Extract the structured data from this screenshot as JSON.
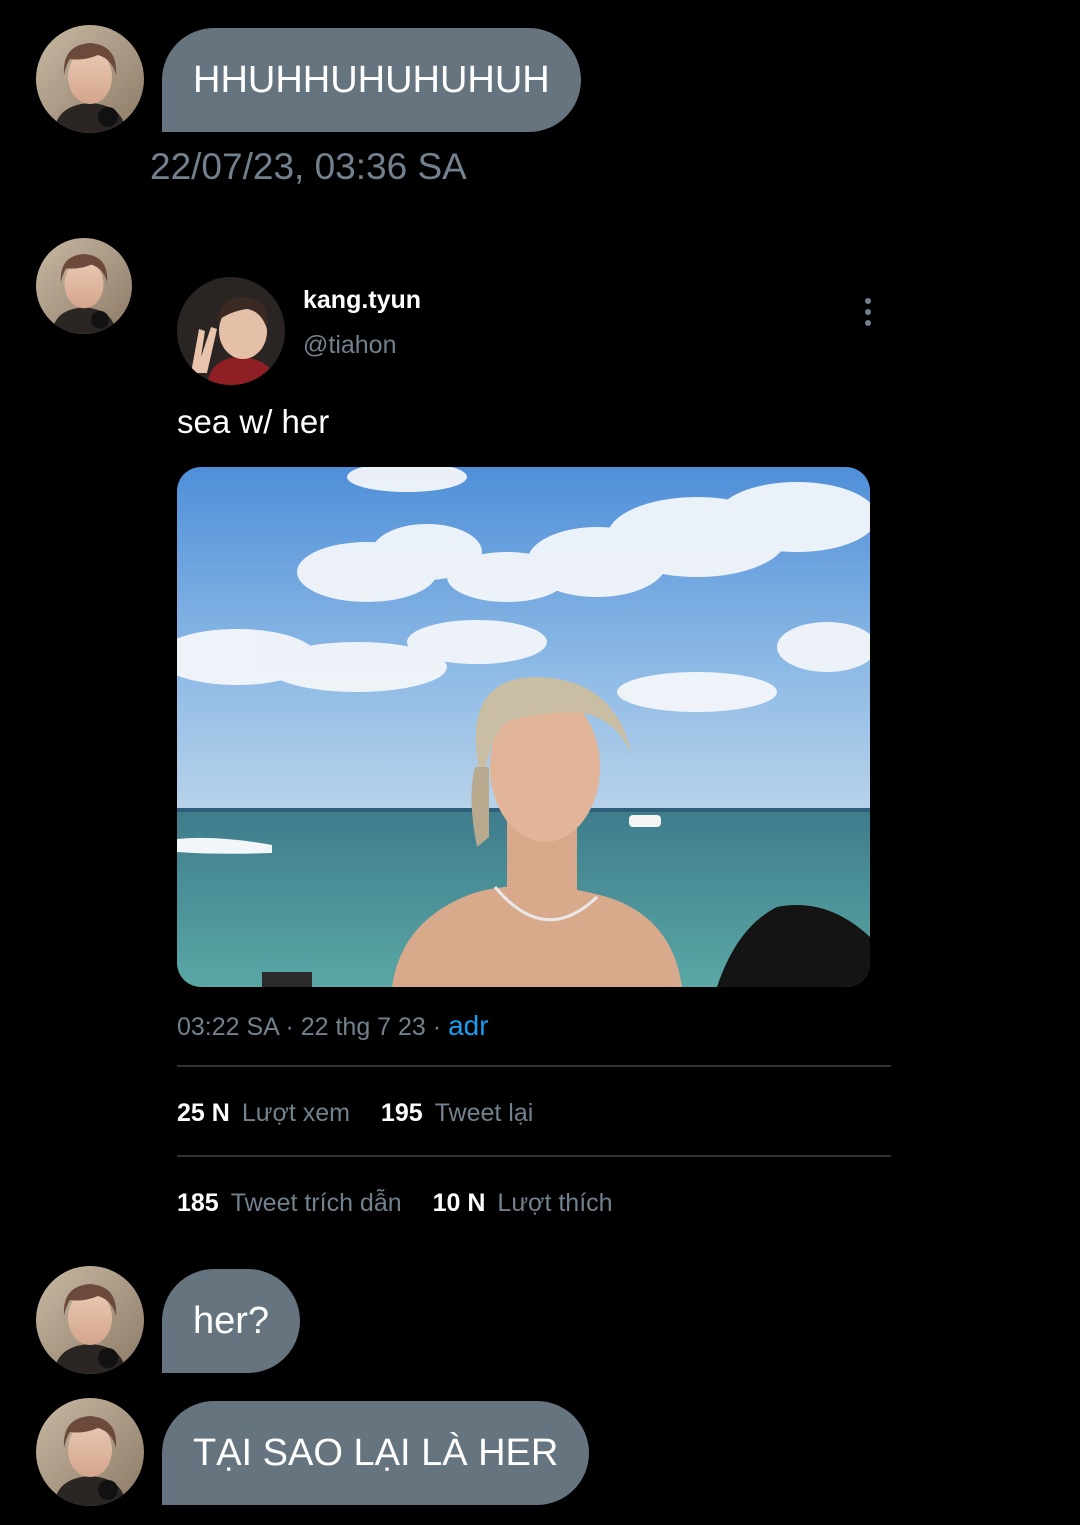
{
  "messages": [
    {
      "text": "HHUHHUHUHUHUH"
    },
    {
      "text": "her?"
    },
    {
      "text": "TẠI SAO LẠI LÀ HER"
    }
  ],
  "timestamp": "22/07/23, 03:36 SA",
  "tweet": {
    "display_name": "kang.tyun",
    "handle": "@tiahon",
    "text": "sea w/ her",
    "time": "03:22 SA",
    "separator": "·",
    "date": "22 thg 7 23",
    "source": "adr",
    "stats": {
      "views": {
        "num": "25 N",
        "label": "Lượt xem"
      },
      "retweets": {
        "num": "195",
        "label": "Tweet lại"
      },
      "quotes": {
        "num": "185",
        "label": "Tweet trích dẫn"
      },
      "likes": {
        "num": "10 N",
        "label": "Lượt thích"
      }
    }
  },
  "colors": {
    "background": "#000000",
    "bubble": "#66747f",
    "muted_text": "#71818d",
    "link": "#1d9bf0",
    "divider": "#2f3336"
  }
}
